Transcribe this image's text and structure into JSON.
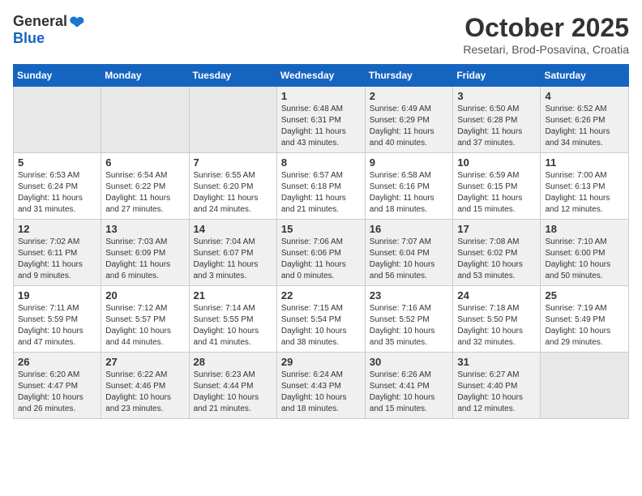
{
  "header": {
    "logo_general": "General",
    "logo_blue": "Blue",
    "month_title": "October 2025",
    "location": "Resetari, Brod-Posavina, Croatia"
  },
  "weekdays": [
    "Sunday",
    "Monday",
    "Tuesday",
    "Wednesday",
    "Thursday",
    "Friday",
    "Saturday"
  ],
  "weeks": [
    [
      {
        "day": "",
        "empty": true
      },
      {
        "day": "",
        "empty": true
      },
      {
        "day": "",
        "empty": true
      },
      {
        "day": "1",
        "sunrise": "6:48 AM",
        "sunset": "6:31 PM",
        "daylight": "11 hours and 43 minutes."
      },
      {
        "day": "2",
        "sunrise": "6:49 AM",
        "sunset": "6:29 PM",
        "daylight": "11 hours and 40 minutes."
      },
      {
        "day": "3",
        "sunrise": "6:50 AM",
        "sunset": "6:28 PM",
        "daylight": "11 hours and 37 minutes."
      },
      {
        "day": "4",
        "sunrise": "6:52 AM",
        "sunset": "6:26 PM",
        "daylight": "11 hours and 34 minutes."
      }
    ],
    [
      {
        "day": "5",
        "sunrise": "6:53 AM",
        "sunset": "6:24 PM",
        "daylight": "11 hours and 31 minutes."
      },
      {
        "day": "6",
        "sunrise": "6:54 AM",
        "sunset": "6:22 PM",
        "daylight": "11 hours and 27 minutes."
      },
      {
        "day": "7",
        "sunrise": "6:55 AM",
        "sunset": "6:20 PM",
        "daylight": "11 hours and 24 minutes."
      },
      {
        "day": "8",
        "sunrise": "6:57 AM",
        "sunset": "6:18 PM",
        "daylight": "11 hours and 21 minutes."
      },
      {
        "day": "9",
        "sunrise": "6:58 AM",
        "sunset": "6:16 PM",
        "daylight": "11 hours and 18 minutes."
      },
      {
        "day": "10",
        "sunrise": "6:59 AM",
        "sunset": "6:15 PM",
        "daylight": "11 hours and 15 minutes."
      },
      {
        "day": "11",
        "sunrise": "7:00 AM",
        "sunset": "6:13 PM",
        "daylight": "11 hours and 12 minutes."
      }
    ],
    [
      {
        "day": "12",
        "sunrise": "7:02 AM",
        "sunset": "6:11 PM",
        "daylight": "11 hours and 9 minutes."
      },
      {
        "day": "13",
        "sunrise": "7:03 AM",
        "sunset": "6:09 PM",
        "daylight": "11 hours and 6 minutes."
      },
      {
        "day": "14",
        "sunrise": "7:04 AM",
        "sunset": "6:07 PM",
        "daylight": "11 hours and 3 minutes."
      },
      {
        "day": "15",
        "sunrise": "7:06 AM",
        "sunset": "6:06 PM",
        "daylight": "11 hours and 0 minutes."
      },
      {
        "day": "16",
        "sunrise": "7:07 AM",
        "sunset": "6:04 PM",
        "daylight": "10 hours and 56 minutes."
      },
      {
        "day": "17",
        "sunrise": "7:08 AM",
        "sunset": "6:02 PM",
        "daylight": "10 hours and 53 minutes."
      },
      {
        "day": "18",
        "sunrise": "7:10 AM",
        "sunset": "6:00 PM",
        "daylight": "10 hours and 50 minutes."
      }
    ],
    [
      {
        "day": "19",
        "sunrise": "7:11 AM",
        "sunset": "5:59 PM",
        "daylight": "10 hours and 47 minutes."
      },
      {
        "day": "20",
        "sunrise": "7:12 AM",
        "sunset": "5:57 PM",
        "daylight": "10 hours and 44 minutes."
      },
      {
        "day": "21",
        "sunrise": "7:14 AM",
        "sunset": "5:55 PM",
        "daylight": "10 hours and 41 minutes."
      },
      {
        "day": "22",
        "sunrise": "7:15 AM",
        "sunset": "5:54 PM",
        "daylight": "10 hours and 38 minutes."
      },
      {
        "day": "23",
        "sunrise": "7:16 AM",
        "sunset": "5:52 PM",
        "daylight": "10 hours and 35 minutes."
      },
      {
        "day": "24",
        "sunrise": "7:18 AM",
        "sunset": "5:50 PM",
        "daylight": "10 hours and 32 minutes."
      },
      {
        "day": "25",
        "sunrise": "7:19 AM",
        "sunset": "5:49 PM",
        "daylight": "10 hours and 29 minutes."
      }
    ],
    [
      {
        "day": "26",
        "sunrise": "6:20 AM",
        "sunset": "4:47 PM",
        "daylight": "10 hours and 26 minutes."
      },
      {
        "day": "27",
        "sunrise": "6:22 AM",
        "sunset": "4:46 PM",
        "daylight": "10 hours and 23 minutes."
      },
      {
        "day": "28",
        "sunrise": "6:23 AM",
        "sunset": "4:44 PM",
        "daylight": "10 hours and 21 minutes."
      },
      {
        "day": "29",
        "sunrise": "6:24 AM",
        "sunset": "4:43 PM",
        "daylight": "10 hours and 18 minutes."
      },
      {
        "day": "30",
        "sunrise": "6:26 AM",
        "sunset": "4:41 PM",
        "daylight": "10 hours and 15 minutes."
      },
      {
        "day": "31",
        "sunrise": "6:27 AM",
        "sunset": "4:40 PM",
        "daylight": "10 hours and 12 minutes."
      },
      {
        "day": "",
        "empty": true
      }
    ]
  ]
}
